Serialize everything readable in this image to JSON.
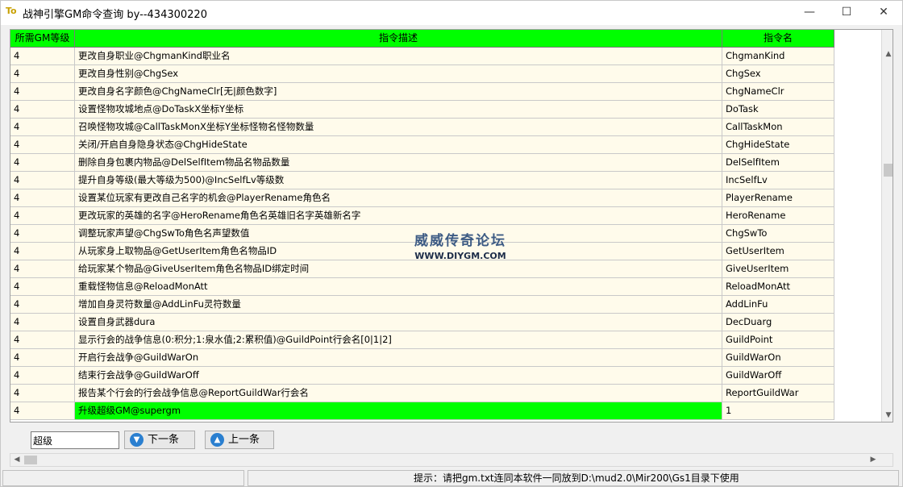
{
  "window": {
    "icon": "To",
    "title": "战神引擎GM命令查询  by--434300220",
    "minimize": "—",
    "maximize": "☐",
    "close": "✕"
  },
  "grid": {
    "columns": [
      "所需GM等级",
      "指令描述",
      "指令名"
    ],
    "rows": [
      {
        "level": "4",
        "desc": "更改自身职业@ChgmanKind职业名",
        "cmd": "ChgmanKind"
      },
      {
        "level": "4",
        "desc": "更改自身性别@ChgSex",
        "cmd": "ChgSex"
      },
      {
        "level": "4",
        "desc": "更改自身名字颜色@ChgNameClr[无|颜色数字]",
        "cmd": "ChgNameClr"
      },
      {
        "level": "4",
        "desc": "设置怪物攻城地点@DoTaskX坐标Y坐标",
        "cmd": "DoTask"
      },
      {
        "level": "4",
        "desc": "召唤怪物攻城@CallTaskMonX坐标Y坐标怪物名怪物数量",
        "cmd": "CallTaskMon"
      },
      {
        "level": "4",
        "desc": "关闭/开启自身隐身状态@ChgHideState",
        "cmd": "ChgHideState"
      },
      {
        "level": "4",
        "desc": "删除自身包裹内物品@DelSelfItem物品名物品数量",
        "cmd": "DelSelfItem"
      },
      {
        "level": "4",
        "desc": "提升自身等级(最大等级为500)@IncSelfLv等级数",
        "cmd": "IncSelfLv"
      },
      {
        "level": "4",
        "desc": "设置某位玩家有更改自己名字的机会@PlayerRename角色名",
        "cmd": "PlayerRename"
      },
      {
        "level": "4",
        "desc": "更改玩家的英雄的名字@HeroRename角色名英雄旧名字英雄新名字",
        "cmd": "HeroRename"
      },
      {
        "level": "4",
        "desc": "调整玩家声望@ChgSwTo角色名声望数值",
        "cmd": "ChgSwTo"
      },
      {
        "level": "4",
        "desc": "从玩家身上取物品@GetUserItem角色名物品ID",
        "cmd": "GetUserItem"
      },
      {
        "level": "4",
        "desc": "给玩家某个物品@GiveUserItem角色名物品ID绑定时间",
        "cmd": "GiveUserItem"
      },
      {
        "level": "4",
        "desc": "重载怪物信息@ReloadMonAtt",
        "cmd": "ReloadMonAtt"
      },
      {
        "level": "4",
        "desc": "增加自身灵符数量@AddLinFu灵符数量",
        "cmd": "AddLinFu"
      },
      {
        "level": "4",
        "desc": "设置自身武器dura",
        "cmd": "DecDuarg"
      },
      {
        "level": "4",
        "desc": "显示行会的战争信息(0:积分;1:泉水值;2:累积值)@GuildPoint行会名[0|1|2]",
        "cmd": "GuildPoint"
      },
      {
        "level": "4",
        "desc": "开启行会战争@GuildWarOn",
        "cmd": "GuildWarOn"
      },
      {
        "level": "4",
        "desc": "结束行会战争@GuildWarOff",
        "cmd": "GuildWarOff"
      },
      {
        "level": "4",
        "desc": "报告某个行会的行会战争信息@ReportGuildWar行会名",
        "cmd": "ReportGuildWar"
      },
      {
        "level": "4",
        "desc": "升级超级GM@supergm",
        "cmd": "1",
        "selected": true
      }
    ]
  },
  "watermark": {
    "line1": "威威传奇论坛",
    "line2": "WWW.DIYGM.COM"
  },
  "search": {
    "value": "超级",
    "next_label": "下一条",
    "prev_label": "上一条"
  },
  "status": {
    "text": "提示：请把gm.txt连同本软件一同放到D:\\mud2.0\\Mir200\\Gs1目录下使用"
  },
  "colors": {
    "header_bg": "#00ff00",
    "row_bg": "#fffbeb",
    "selected_bg": "#00ff00"
  }
}
